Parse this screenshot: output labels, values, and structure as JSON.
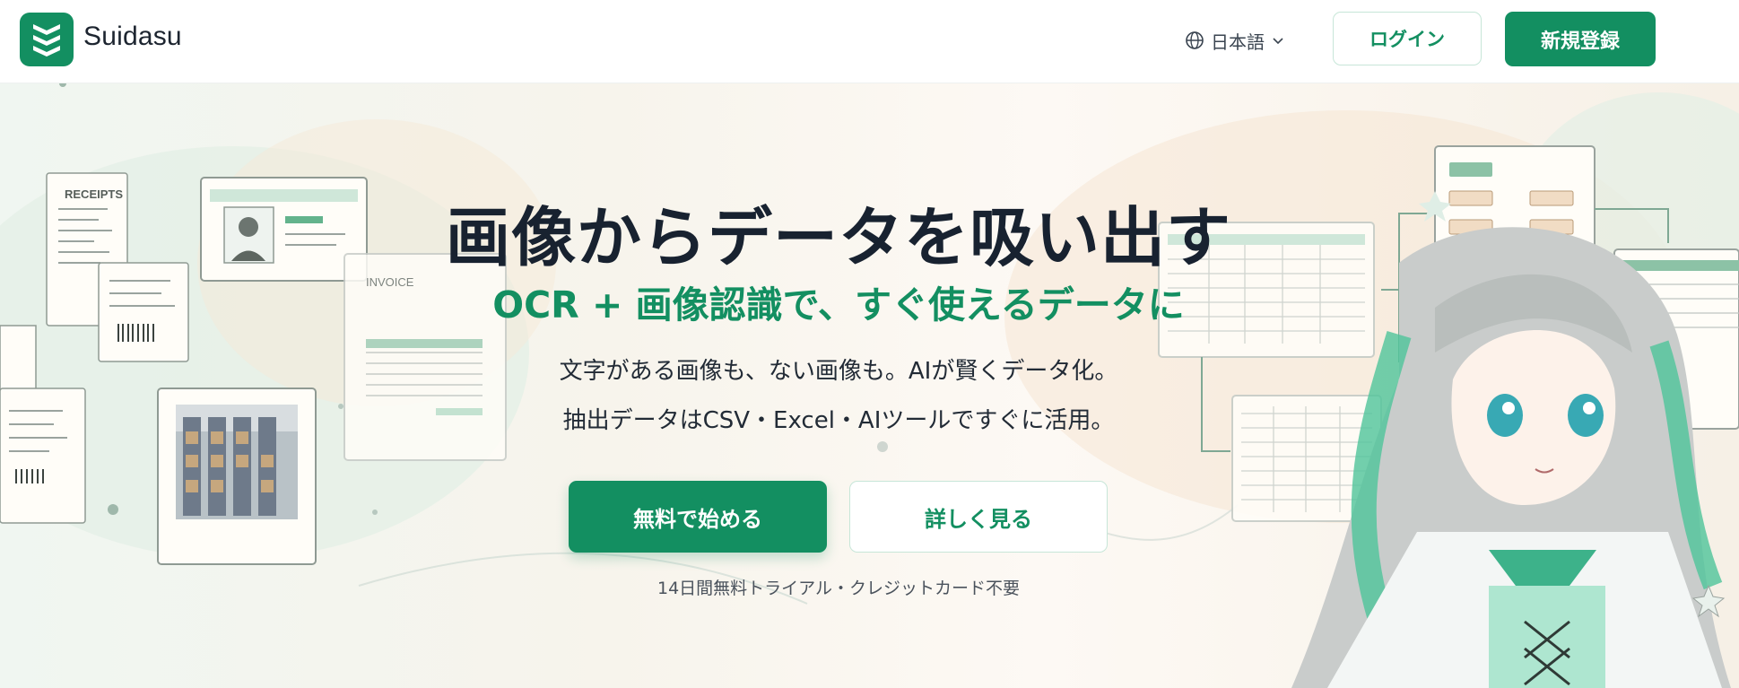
{
  "header": {
    "brand": "Suidasu",
    "language": "日本語",
    "login_label": "ログイン",
    "register_label": "新規登録"
  },
  "hero": {
    "title": "画像からデータを吸い出す",
    "subtitle": "OCR + 画像認識で、すぐ使えるデータに",
    "description_line1": "文字がある画像も、ない画像も。AIが賢くデータ化。",
    "description_line2": "抽出データはCSV・Excel・AIツールですぐに活用。",
    "cta_primary": "無料で始める",
    "cta_secondary": "詳しく見る",
    "note": "14日間無料トライアル・クレジットカード不要"
  },
  "illustration": {
    "receipts_label": "RECEIPTS",
    "invoice_label": "INVOICE"
  },
  "colors": {
    "brand_green": "#138f61",
    "text_dark": "#182230",
    "border_mint": "#c7e6d8"
  },
  "icons": {
    "logo": "chevron-stack-logo",
    "language": "globe-icon",
    "dropdown": "chevron-down-icon"
  }
}
